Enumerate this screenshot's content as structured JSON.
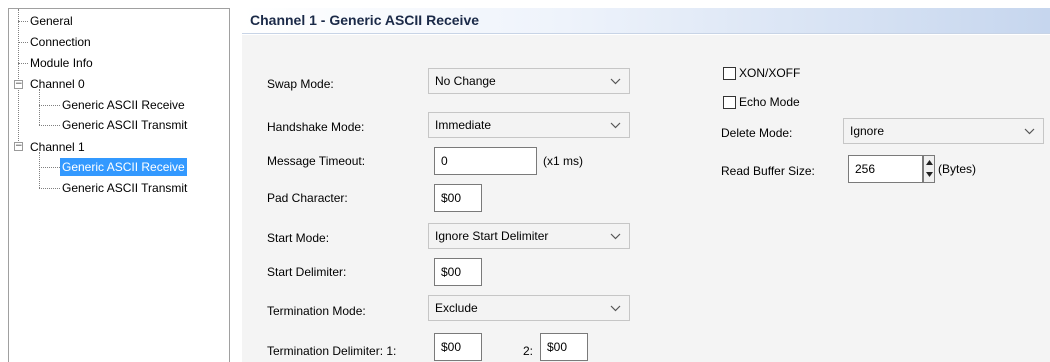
{
  "tree": {
    "general": "General",
    "connection": "Connection",
    "module_info": "Module Info",
    "channel0": "Channel 0",
    "ch0_receive": "Generic ASCII Receive",
    "ch0_transmit": "Generic ASCII Transmit",
    "channel1": "Channel 1",
    "ch1_receive": "Generic ASCII Receive",
    "ch1_transmit": "Generic ASCII Transmit",
    "selected": "ch1_receive"
  },
  "header": {
    "title": "Channel 1 - Generic ASCII Receive"
  },
  "form": {
    "swap_mode": {
      "label": "Swap Mode:",
      "value": "No Change"
    },
    "handshake_mode": {
      "label": "Handshake Mode:",
      "value": "Immediate"
    },
    "message_timeout": {
      "label": "Message Timeout:",
      "value": "0",
      "unit": "(x1 ms)"
    },
    "pad_character": {
      "label": "Pad Character:",
      "value": "$00"
    },
    "start_mode": {
      "label": "Start Mode:",
      "value": "Ignore Start Delimiter"
    },
    "start_delimiter": {
      "label": "Start Delimiter:",
      "value": "$00"
    },
    "termination_mode": {
      "label": "Termination Mode:",
      "value": "Exclude"
    },
    "termination_delimiter": {
      "label": "Termination Delimiter: 1:",
      "value1": "$00",
      "label2": "2:",
      "value2": "$00"
    },
    "xon_xoff": {
      "label": "XON/XOFF",
      "checked": false
    },
    "echo_mode": {
      "label": "Echo Mode",
      "checked": false
    },
    "delete_mode": {
      "label": "Delete Mode:",
      "value": "Ignore"
    },
    "read_buffer_size": {
      "label": "Read Buffer Size:",
      "value": "256",
      "unit": "(Bytes)"
    }
  },
  "icons": {
    "collapse": "minus-box-icon",
    "dropdown": "chevron-down-icon",
    "spin_up": "triangle-up-icon",
    "spin_down": "triangle-down-icon"
  },
  "colors": {
    "selection": "#3399ff",
    "header_gradient_end": "#c6d6ee",
    "content_bg": "#f4f4f4"
  }
}
